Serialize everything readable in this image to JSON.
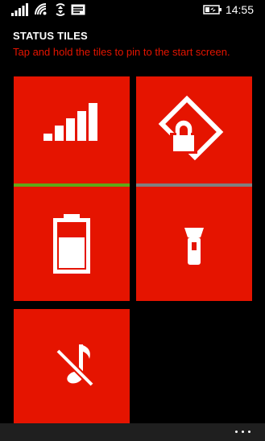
{
  "status_bar": {
    "time": "14:55",
    "icons": [
      "signal-strength-icon",
      "wifi-icon",
      "data-sense-icon",
      "message-icon",
      "battery-charging-icon"
    ]
  },
  "header": {
    "title": "STATUS TILES",
    "subtitle": "Tap and hold the tiles to pin to the start screen."
  },
  "theme": {
    "accent": "#e51400",
    "background": "#000000",
    "app_bar": "#1f1f1f",
    "signal_bar_color": "#60a917",
    "rotation_bar_color": "#808080"
  },
  "tiles": [
    {
      "id": "cellular-signal",
      "icon": "cellular-signal-icon",
      "status_bar": "green"
    },
    {
      "id": "rotation-lock",
      "icon": "rotation-lock-icon",
      "status_bar": "gray"
    },
    {
      "id": "battery",
      "icon": "battery-icon"
    },
    {
      "id": "flashlight",
      "icon": "flashlight-icon"
    },
    {
      "id": "ringer",
      "icon": "ringer-off-icon"
    }
  ],
  "app_bar": {
    "menu_icon": "more-icon"
  }
}
